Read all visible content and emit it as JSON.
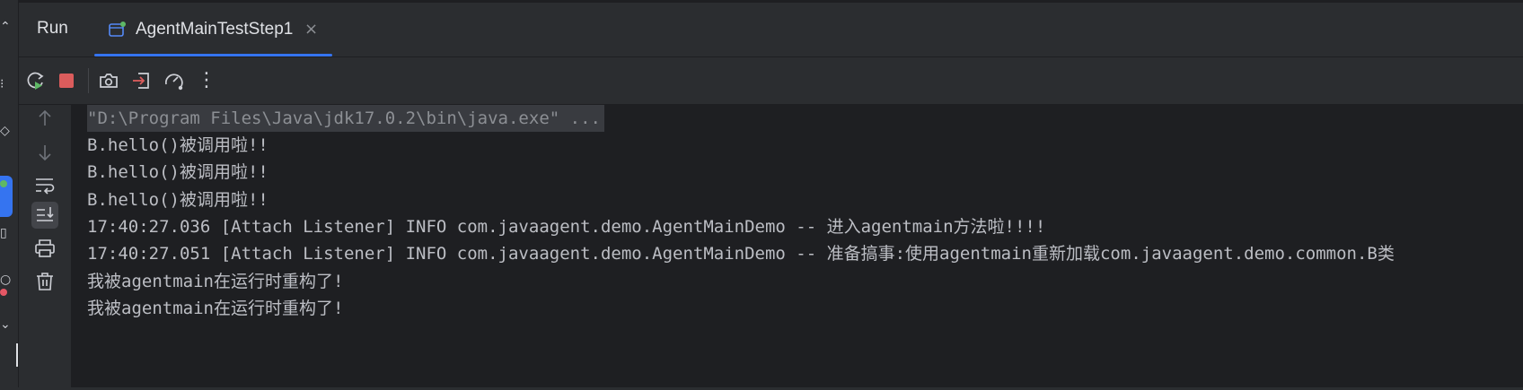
{
  "tool_window": {
    "title": "Run"
  },
  "tab": {
    "label": "AgentMainTestStep1",
    "close_glyph": "×"
  },
  "toolbar": {
    "buttons": [
      "rerun-icon",
      "stop-icon",
      "screenshot-icon",
      "export-icon",
      "profiler-icon",
      "more-options-icon"
    ],
    "more_glyph": "⋮"
  },
  "side_rail": {
    "buttons": [
      "scroll-up-icon",
      "scroll-down-icon",
      "soft-wrap-icon",
      "scroll-to-end-icon",
      "print-icon",
      "clear-all-icon"
    ],
    "active": "scroll-to-end-icon"
  },
  "console": {
    "lines": [
      "\"D:\\Program Files\\Java\\jdk17.0.2\\bin\\java.exe\" ...",
      "B.hello()被调用啦!!",
      "B.hello()被调用啦!!",
      "B.hello()被调用啦!!",
      "17:40:27.036 [Attach Listener] INFO com.javaagent.demo.AgentMainDemo -- 进入agentmain方法啦!!!!",
      "17:40:27.051 [Attach Listener] INFO com.javaagent.demo.AgentMainDemo -- 准备搞事:使用agentmain重新加载com.javaagent.demo.common.B类",
      "我被agentmain在运行时重构了!",
      "我被agentmain在运行时重构了!"
    ]
  },
  "colors": {
    "accent": "#3574f0",
    "stop": "#db5c5c",
    "run_green": "#5fb865",
    "panel_bg": "#2b2d30",
    "console_bg": "#1e1f22",
    "text": "#bcbec4"
  }
}
